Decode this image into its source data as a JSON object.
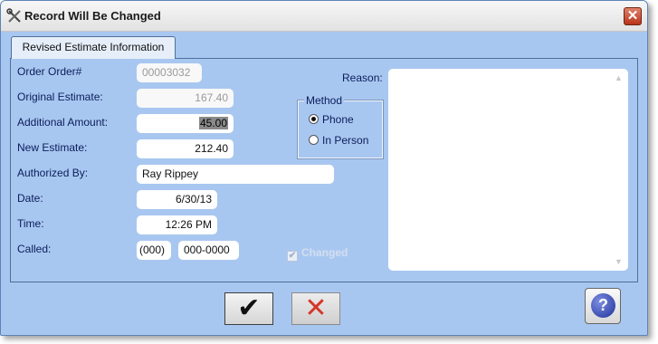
{
  "window": {
    "title": "Record Will Be Changed",
    "close_label": "✕"
  },
  "tab": {
    "label": "Revised Estimate Information"
  },
  "fields": {
    "order_label": "Order Order#",
    "order_value": "00003032",
    "original_label": "Original Estimate:",
    "original_value": "167.40",
    "additional_label": "Additional Amount:",
    "additional_value": "45.00",
    "new_label": "New Estimate:",
    "new_value": "212.40",
    "authorized_label": "Authorized By:",
    "authorized_value": "Ray Rippey",
    "date_label": "Date:",
    "date_value": "6/30/13",
    "time_label": "Time:",
    "time_value": "12:26 PM",
    "called_label": "Called:",
    "area_code": "(000)",
    "phone_number": "000-0000"
  },
  "method": {
    "title": "Method",
    "options": [
      "Phone",
      "In Person"
    ],
    "selected": "Phone"
  },
  "changed": {
    "label": "Changed",
    "checked": true
  },
  "reason": {
    "label": "Reason:",
    "value": ""
  },
  "buttons": {
    "ok_symbol": "✔",
    "cancel_symbol": "✕",
    "help_symbol": "?"
  },
  "colors": {
    "background": "#a8c7f0",
    "label_text": "#0b1d5c",
    "cancel_red": "#d6362a"
  }
}
